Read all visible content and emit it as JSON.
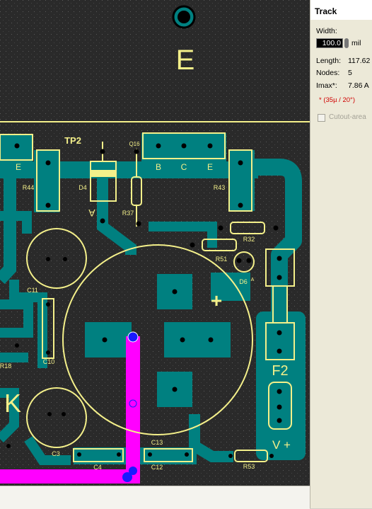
{
  "panel": {
    "title": "Track",
    "width_label": "Width:",
    "width_value": "100.0",
    "width_unit": "mil",
    "length_label": "Length:",
    "length_value": "117.62",
    "nodes_label": "Nodes:",
    "nodes_value": "5",
    "imax_label": "Imax*:",
    "imax_value": "7.86 A",
    "note": "* (35µ / 20°)",
    "cutout_label": "Cutout-area",
    "cutout_checked": false
  },
  "board": {
    "labels": {
      "big_e": "E",
      "tp2": "TP2",
      "q16": "Q16",
      "e_left": "E",
      "b": "B",
      "c": "C",
      "e_right": "E",
      "r44": "R44",
      "d4": "D4",
      "a_d4": "A",
      "r37": "R37",
      "r43": "R43",
      "r32": "R32",
      "r51": "R51",
      "d6": "D6",
      "d6_a": "A",
      "c11": "C11",
      "c10": "C10",
      "r18": "R18",
      "big_k": "K",
      "c3": "C3",
      "c4": "C4",
      "c13": "C13",
      "c12": "C12",
      "r53": "R53",
      "f2": "F2",
      "v_plus": "V +",
      "plus_sign": "+"
    }
  },
  "colors": {
    "background": "#2a2a2a",
    "copper": "#008080",
    "silkscreen": "#f4f08a",
    "selected_track": "#ff00ff",
    "selected_node": "#1a1aff"
  }
}
